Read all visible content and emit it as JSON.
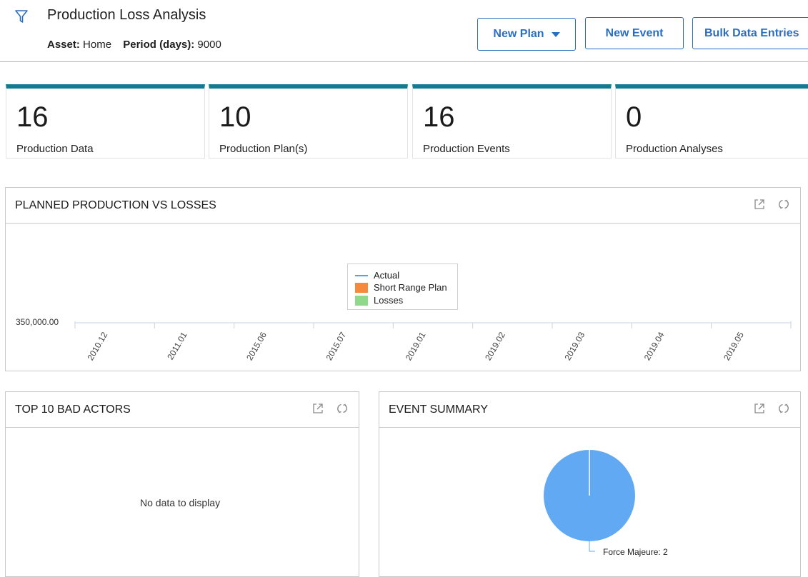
{
  "header": {
    "title": "Production Loss Analysis",
    "asset_label": "Asset:",
    "asset_value": "Home",
    "period_label": "Period (days):",
    "period_value": "9000",
    "icons": {
      "filter": "filter-icon"
    }
  },
  "buttons": {
    "new_plan": "New Plan",
    "new_event": "New Event",
    "bulk": "Bulk Data Entries"
  },
  "kpis": [
    {
      "value": "16",
      "label": "Production Data"
    },
    {
      "value": "10",
      "label": "Production Plan(s)"
    },
    {
      "value": "16",
      "label": "Production Events"
    },
    {
      "value": "0",
      "label": "Production Analyses"
    }
  ],
  "colors": {
    "accent": "#137b91",
    "button": "#2a6ebf",
    "actual": "#5aa0e6",
    "short_range_plan": "#f58a3c",
    "losses": "#8fd98a",
    "pie": "#61a9f2"
  },
  "panels": {
    "planned": {
      "title": "PLANNED PRODUCTION VS LOSSES"
    },
    "bad_actors": {
      "title": "TOP 10 BAD ACTORS",
      "empty": "No data to display"
    },
    "event_summary": {
      "title": "EVENT SUMMARY"
    },
    "icons": [
      "external-link-icon",
      "refresh-icon"
    ]
  },
  "chart_data": [
    {
      "type": "line",
      "title": "PLANNED PRODUCTION VS LOSSES",
      "categories": [
        "2010.12",
        "2011.01",
        "2015.06",
        "2015.07",
        "2019.01",
        "2019.02",
        "2019.03",
        "2019.04",
        "2019.05"
      ],
      "y_tick_labels": [
        "350,000.00"
      ],
      "series": [
        {
          "name": "Actual",
          "values": []
        },
        {
          "name": "Short Range Plan",
          "values": []
        },
        {
          "name": "Losses",
          "values": []
        }
      ],
      "legend": "top-center"
    },
    {
      "type": "pie",
      "title": "EVENT SUMMARY",
      "slices": [
        {
          "label": "Force Majeure",
          "value": 2
        }
      ],
      "slice_label": "Force Majeure: 2"
    }
  ]
}
